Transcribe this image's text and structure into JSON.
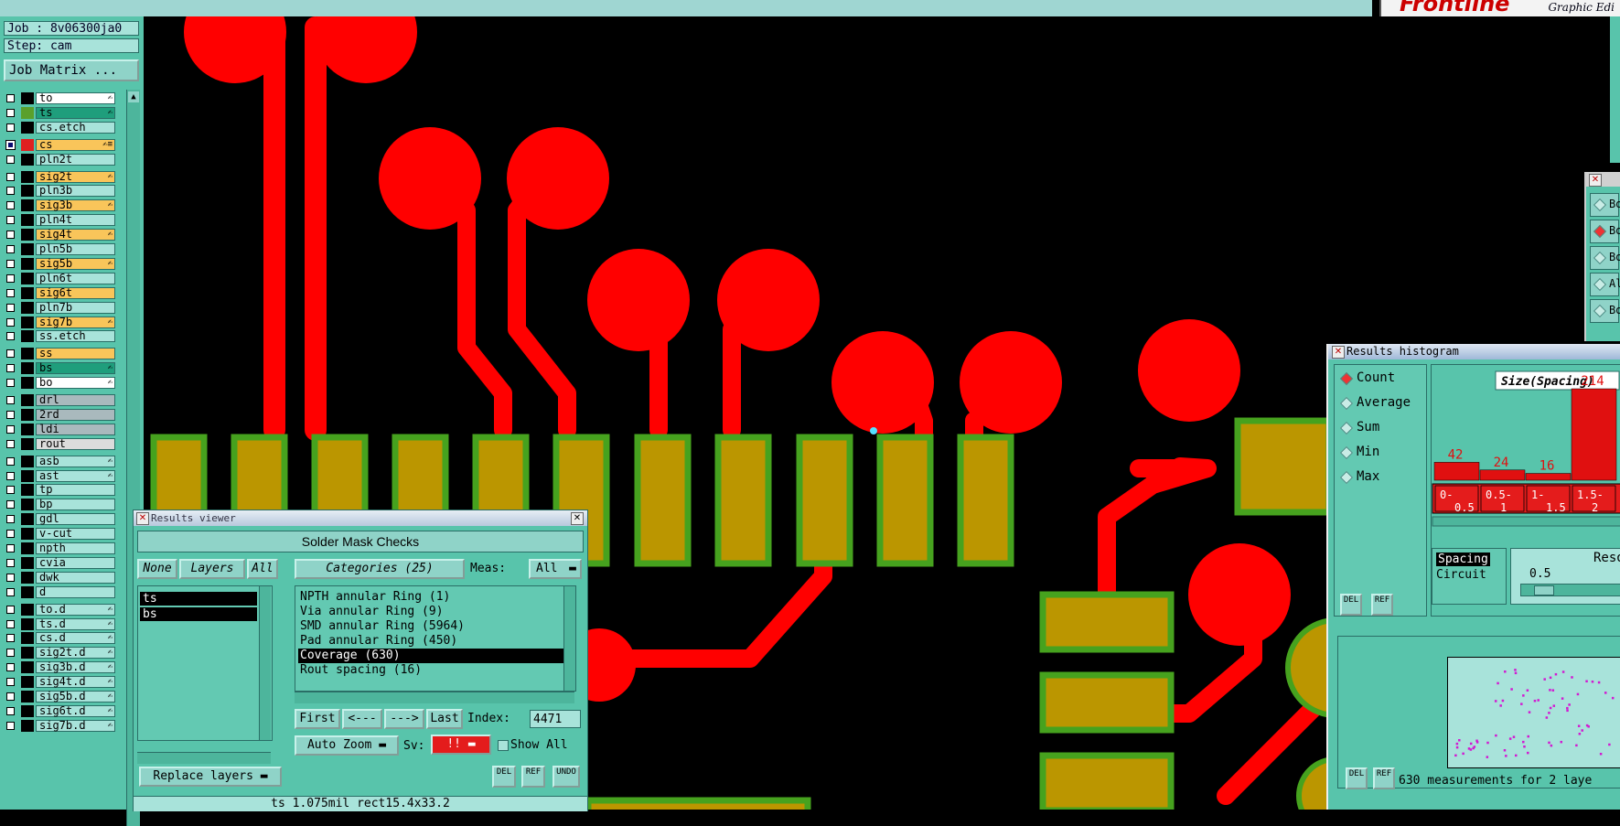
{
  "app": {
    "brand": "Frontline",
    "subtitle": "Graphic Edi"
  },
  "job": {
    "job_label": "Job : 8v06300ja0",
    "step_label": "Step: cam",
    "job_matrix_button": "Job Matrix ..."
  },
  "layers": [
    {
      "name": "to",
      "sw": "#000",
      "bg": "#ffffff",
      "flag": "✍",
      "checked": false
    },
    {
      "name": "ts",
      "sw": "#5aa02c",
      "bg": "#1f9e7c",
      "flag": "✍",
      "checked": false
    },
    {
      "name": "cs.etch",
      "sw": "#000",
      "bg": "#a8e3da",
      "flag": "",
      "checked": false
    },
    {
      "name": "cs",
      "sw": "#e02020",
      "bg": "#f9c55a",
      "flag": "✍≡",
      "checked": true
    },
    {
      "name": "pln2t",
      "sw": "#000",
      "bg": "#a8e3da",
      "flag": "",
      "checked": false
    },
    {
      "name": "sig2t",
      "sw": "#000",
      "bg": "#f9c55a",
      "flag": "✍",
      "checked": false
    },
    {
      "name": "pln3b",
      "sw": "#000",
      "bg": "#a8e3da",
      "flag": "",
      "checked": false
    },
    {
      "name": "sig3b",
      "sw": "#000",
      "bg": "#f9c55a",
      "flag": "✍",
      "checked": false
    },
    {
      "name": "pln4t",
      "sw": "#000",
      "bg": "#a8e3da",
      "flag": "",
      "checked": false
    },
    {
      "name": "sig4t",
      "sw": "#000",
      "bg": "#f9c55a",
      "flag": "✍",
      "checked": false
    },
    {
      "name": "pln5b",
      "sw": "#000",
      "bg": "#a8e3da",
      "flag": "",
      "checked": false
    },
    {
      "name": "sig5b",
      "sw": "#000",
      "bg": "#f9c55a",
      "flag": "✍",
      "checked": false
    },
    {
      "name": "pln6t",
      "sw": "#000",
      "bg": "#a8e3da",
      "flag": "",
      "checked": false
    },
    {
      "name": "sig6t",
      "sw": "#000",
      "bg": "#f9c55a",
      "flag": "",
      "checked": false
    },
    {
      "name": "pln7b",
      "sw": "#000",
      "bg": "#a8e3da",
      "flag": "",
      "checked": false
    },
    {
      "name": "sig7b",
      "sw": "#000",
      "bg": "#f9c55a",
      "flag": "✍",
      "checked": false
    },
    {
      "name": "ss.etch",
      "sw": "#000",
      "bg": "#a8e3da",
      "flag": "",
      "checked": false
    },
    {
      "name": "ss",
      "sw": "#000",
      "bg": "#f9c55a",
      "flag": "",
      "checked": false
    },
    {
      "name": "bs",
      "sw": "#000",
      "bg": "#1f9e7c",
      "flag": "✍",
      "checked": false
    },
    {
      "name": "bo",
      "sw": "#000",
      "bg": "#ffffff",
      "flag": "✍",
      "checked": false
    },
    {
      "name": "drl",
      "sw": "#000",
      "bg": "#a9b9bd",
      "flag": "",
      "checked": false
    },
    {
      "name": "2rd",
      "sw": "#000",
      "bg": "#a9b9bd",
      "flag": "",
      "checked": false
    },
    {
      "name": "ldi",
      "sw": "#000",
      "bg": "#a9b9bd",
      "flag": "",
      "checked": false
    },
    {
      "name": "rout",
      "sw": "#000",
      "bg": "#dcdcdc",
      "flag": "",
      "checked": false
    },
    {
      "name": "asb",
      "sw": "#000",
      "bg": "#a8e3da",
      "flag": "✍",
      "checked": false
    },
    {
      "name": "ast",
      "sw": "#000",
      "bg": "#a8e3da",
      "flag": "✍",
      "checked": false
    },
    {
      "name": "tp",
      "sw": "#000",
      "bg": "#a8e3da",
      "flag": "",
      "checked": false
    },
    {
      "name": "bp",
      "sw": "#000",
      "bg": "#a8e3da",
      "flag": "",
      "checked": false
    },
    {
      "name": "gdl",
      "sw": "#000",
      "bg": "#a8e3da",
      "flag": "",
      "checked": false
    },
    {
      "name": "v-cut",
      "sw": "#000",
      "bg": "#a8e3da",
      "flag": "",
      "checked": false
    },
    {
      "name": "npth",
      "sw": "#000",
      "bg": "#a8e3da",
      "flag": "",
      "checked": false
    },
    {
      "name": "cvia",
      "sw": "#000",
      "bg": "#a8e3da",
      "flag": "",
      "checked": false
    },
    {
      "name": "dwk",
      "sw": "#000",
      "bg": "#a8e3da",
      "flag": "",
      "checked": false
    },
    {
      "name": "d",
      "sw": "#000",
      "bg": "#a8e3da",
      "flag": "",
      "checked": false
    },
    {
      "name": "to.d",
      "sw": "#000",
      "bg": "#a8e3da",
      "flag": "✍",
      "checked": false
    },
    {
      "name": "ts.d",
      "sw": "#000",
      "bg": "#a8e3da",
      "flag": "✍",
      "checked": false
    },
    {
      "name": "cs.d",
      "sw": "#000",
      "bg": "#a8e3da",
      "flag": "✍",
      "checked": false
    },
    {
      "name": "sig2t.d",
      "sw": "#000",
      "bg": "#a8e3da",
      "flag": "✍",
      "checked": false
    },
    {
      "name": "sig3b.d",
      "sw": "#000",
      "bg": "#a8e3da",
      "flag": "✍",
      "checked": false
    },
    {
      "name": "sig4t.d",
      "sw": "#000",
      "bg": "#a8e3da",
      "flag": "✍",
      "checked": false
    },
    {
      "name": "sig5b.d",
      "sw": "#000",
      "bg": "#a8e3da",
      "flag": "✍",
      "checked": false
    },
    {
      "name": "sig6t.d",
      "sw": "#000",
      "bg": "#a8e3da",
      "flag": "✍",
      "checked": false
    },
    {
      "name": "sig7b.d",
      "sw": "#000",
      "bg": "#a8e3da",
      "flag": "✍",
      "checked": false
    }
  ],
  "results_viewer": {
    "title": "Results viewer",
    "header": "Solder Mask Checks",
    "none_btn": "None",
    "layers_btn": "Layers",
    "all_btn": "All",
    "categories_btn": "Categories (25)",
    "meas_label": "Meas:",
    "meas_value": "All",
    "selected_layers": [
      "ts",
      "bs"
    ],
    "categories": [
      {
        "label": "NPTH annular Ring (1)",
        "selected": false
      },
      {
        "label": "Via annular Ring (9)",
        "selected": false
      },
      {
        "label": "SMD annular Ring (5964)",
        "selected": false
      },
      {
        "label": "Pad annular Ring (450)",
        "selected": false
      },
      {
        "label": "Coverage (630)",
        "selected": true
      },
      {
        "label": "Rout spacing (16)",
        "selected": false
      }
    ],
    "first_btn": "First",
    "prev_btn": "<---",
    "next_btn": "--->",
    "last_btn": "Last",
    "index_label": "Index:",
    "index_value": "4471",
    "auto_zoom": "Auto Zoom",
    "sv_label": "Sv:",
    "sv_value": "!!",
    "show_all": "Show All",
    "replace_layers": "Replace layers",
    "del_btn": "DEL",
    "ref_btn": "REF",
    "undo_btn": "UNDO",
    "status": "ts 1.075mil  rect15.4x33.2"
  },
  "histogram": {
    "title": "Results histogram",
    "modes": [
      {
        "label": "Count",
        "on": true
      },
      {
        "label": "Average",
        "on": false
      },
      {
        "label": "Sum",
        "on": false
      },
      {
        "label": "Min",
        "on": false
      },
      {
        "label": "Max",
        "on": false
      }
    ],
    "del_btn": "DEL",
    "ref_btn": "REF",
    "types": [
      "Spacing",
      "Circuit"
    ],
    "reso_label": "Reso",
    "reso_value": "0.5",
    "footer": "630 measurements for 2 laye"
  },
  "chart_data": {
    "type": "bar",
    "title": "Size(Spacing)",
    "categories": [
      "0-0.5",
      "0.5-1",
      "1-1.5",
      "1.5-2"
    ],
    "values": [
      42,
      24,
      16,
      214
    ],
    "bar_color": "#e01010"
  },
  "side_window": {
    "options": [
      {
        "label": "Bo",
        "on": false
      },
      {
        "label": "Bo",
        "on": true
      },
      {
        "label": "Bo",
        "on": false
      },
      {
        "label": "Al",
        "on": false
      },
      {
        "label": "Bo",
        "on": false
      }
    ]
  }
}
